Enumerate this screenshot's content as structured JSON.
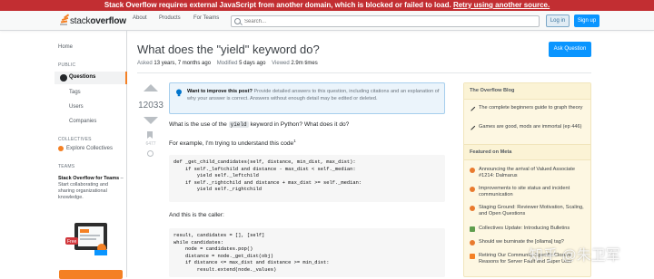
{
  "banner": {
    "text": "Stack Overflow requires external JavaScript from another domain, which is blocked or failed to load.",
    "link": "Retry using another source."
  },
  "header": {
    "logo_prefix": "stack",
    "logo_bold": "overflow",
    "nav": [
      "About",
      "Products",
      "For Teams"
    ],
    "search_placeholder": "Search...",
    "login": "Log in",
    "signup": "Sign up"
  },
  "leftnav": {
    "home": "Home",
    "public_heading": "PUBLIC",
    "questions": "Questions",
    "tags": "Tags",
    "users": "Users",
    "companies": "Companies",
    "collectives_heading": "COLLECTIVES",
    "explore_collectives": "Explore Collectives",
    "teams_heading": "TEAMS",
    "teams_title": "Stack Overflow for Teams",
    "teams_desc": " – Start collaborating and sharing organizational knowledge.",
    "free_badge": "Free"
  },
  "question": {
    "title": "What does the \"yield\" keyword do?",
    "ask_button": "Ask Question",
    "asked_label": "Asked",
    "asked_value": "13 years, 7 months ago",
    "modified_label": "Modified",
    "modified_value": "5 days ago",
    "viewed_label": "Viewed",
    "viewed_value": "2.9m times",
    "votes": "12033",
    "bookmarks": "6477",
    "notice_bold": "Want to improve this post?",
    "notice_text": " Provide detailed answers to this question, including citations and an explanation of why your answer is correct. Answers without enough detail may be edited or deleted.",
    "p1_before": "What is the use of the ",
    "p1_code": "yield",
    "p1_after": " keyword in Python? What does it do?",
    "p2": "For example, I'm trying to understand this code",
    "p2_sup": "1",
    "code1": "def _get_child_candidates(self, distance, min_dist, max_dist):\n    if self._leftchild and distance - max_dist < self._median:\n        yield self._leftchild\n    if self._rightchild and distance + max_dist >= self._median:\n        yield self._rightchild",
    "p3": "And this is the caller:",
    "code2": "result, candidates = [], [self]\nwhile candidates:\n    node = candidates.pop()\n    distance = node._get_dist(obj)\n    if distance <= max_dist and distance >= min_dist:\n        result.extend(node._values)"
  },
  "sidebar": {
    "blog_heading": "The Overflow Blog",
    "blog_items": [
      "The complete beginners guide to graph theory",
      "Games are good, mods are immortal (ep 446)"
    ],
    "meta_heading": "Featured on Meta",
    "meta_items": [
      "Announcing the arrival of Valued Associate #1214: Dalmarus",
      "Improvements to site status and incident communication",
      "Staging Ground: Reviewer Motivation, Scaling, and Open Questions",
      "Collectives Update: Introducing Bulletins",
      "Should we burninate the [ollama] tag?",
      "Retiring Our Community-Specific Closure Reasons for Server Fault and Super User"
    ]
  },
  "watermark": "知乎 @朱卫军"
}
